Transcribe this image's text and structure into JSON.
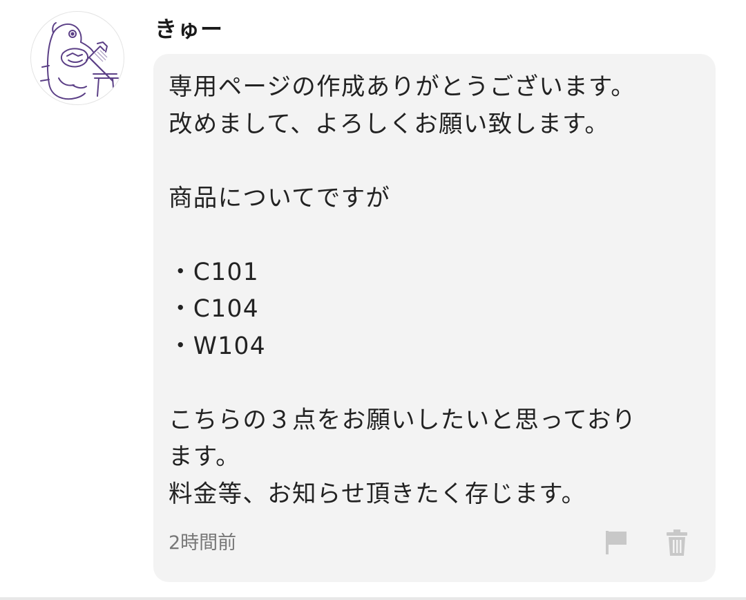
{
  "post": {
    "username": "きゅー",
    "message": "専用ページの作成ありがとうございます。\n改めまして、よろしくお願い致します。\n\n商品についてですが\n\n・C101\n・C104\n・W104\n\nこちらの３点をお願いしたいと思っており\nます。\n料金等、お知らせ頂きたく存じます。",
    "timestamp": "2時間前"
  },
  "icons": {
    "avatar": "avatar-illustration",
    "flag": "flag-icon",
    "trash": "trash-icon"
  },
  "colors": {
    "bubble_background": "#f3f3f3",
    "action_icon": "#c8c8c8",
    "avatar_line": "#5b3f86"
  }
}
